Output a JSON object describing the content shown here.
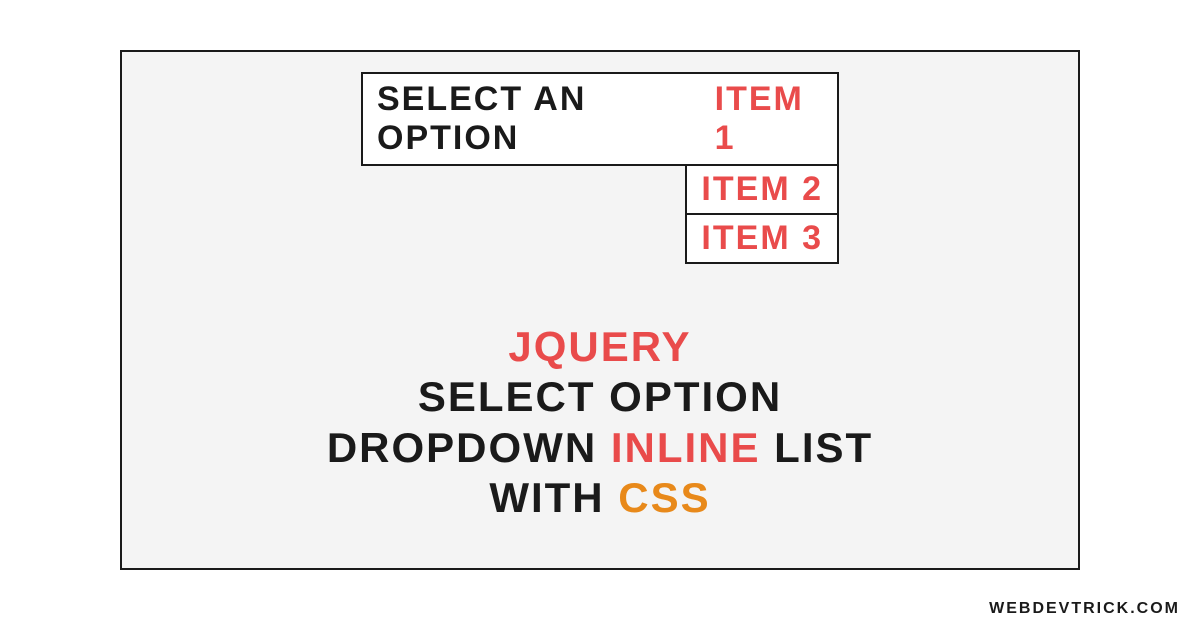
{
  "dropdown": {
    "label": "SELECT AN OPTION",
    "items": [
      "ITEM 1",
      "ITEM 2",
      "ITEM 3"
    ]
  },
  "headline": {
    "word1": "JQUERY",
    "word2": "SELECT OPTION",
    "word3": "DROPDOWN",
    "word4": "INLINE",
    "word5": "LIST",
    "word6": "WITH",
    "word7": "CSS"
  },
  "watermark": "WEBDEVTRICK.COM"
}
